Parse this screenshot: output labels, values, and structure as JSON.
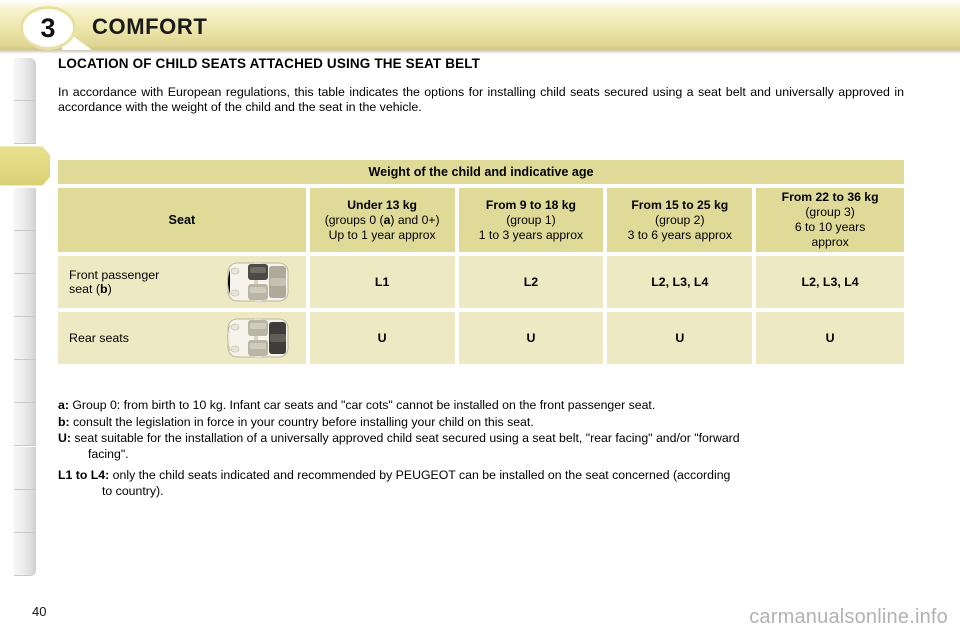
{
  "header": {
    "chapter_number": "3",
    "title": "COMFORT",
    "banner_color": "#ece5a8",
    "badge_border_color": "#e8dfa0"
  },
  "sidebar": {
    "tab_count": 12,
    "active_tab_index": 2,
    "active_tab_color": "#e2d982"
  },
  "content": {
    "section_heading": "LOCATION OF CHILD SEATS ATTACHED USING THE SEAT BELT",
    "intro_paragraph": "In accordance with European regulations, this table indicates the options for installing child seats secured using a seat belt and universally approved in accordance with the weight of the child and the seat in the vehicle."
  },
  "table": {
    "banner_label": "Weight of the child and indicative age",
    "header_colors": {
      "header_cell": "#e0da98",
      "body_cell": "#edeac3"
    },
    "seat_column_header": "Seat",
    "weight_columns": [
      {
        "title": "Under 13 kg",
        "group_prefix": "(groups 0 (",
        "group_bold": "a",
        "group_suffix": ") and 0+)",
        "age": "Up to 1 year approx"
      },
      {
        "title": "From 9 to 18 kg",
        "group": "(group 1)",
        "age": "1 to 3 years approx"
      },
      {
        "title": "From 15 to 25 kg",
        "group": "(group 2)",
        "age": "3 to 6 years approx"
      },
      {
        "title": "From 22 to 36 kg",
        "group": "(group 3)",
        "age_line1": "6 to 10 years",
        "age_line2": "approx"
      }
    ],
    "rows": [
      {
        "seat_label_line1": "Front passenger",
        "seat_label_line2_prefix": "seat (",
        "seat_label_bold": "b",
        "seat_label_line2_suffix": ")",
        "pictogram": "car-top-view-front-passenger-highlighted",
        "values": [
          "L1",
          "L2",
          "L2, L3, L4",
          "L2, L3, L4"
        ]
      },
      {
        "seat_label_line1": "Rear seats",
        "seat_label_line2_prefix": "",
        "seat_label_bold": "",
        "seat_label_line2_suffix": "",
        "pictogram": "car-top-view-rear-seats-highlighted",
        "values": [
          "U",
          "U",
          "U",
          "U"
        ]
      }
    ]
  },
  "footnotes": [
    {
      "key": "a:",
      "text": " Group 0: from birth to 10 kg. Infant car seats and \"car cots\" cannot be installed on the front passenger seat."
    },
    {
      "key": "b:",
      "text": " consult the legislation in force in your country before installing your child on this seat."
    },
    {
      "key": "U:",
      "text": " seat suitable for the installation of a universally approved child seat secured using a seat belt, \"rear facing\" and/or \"forward",
      "continuation": "facing\"."
    },
    {
      "key": "L1 to L4:",
      "text": " only the child seats indicated and recommended by PEUGEOT can be installed on the seat concerned (according",
      "continuation": "to country)."
    }
  ],
  "footer": {
    "page_number": "40",
    "watermark": "carmanualsonline.info"
  }
}
